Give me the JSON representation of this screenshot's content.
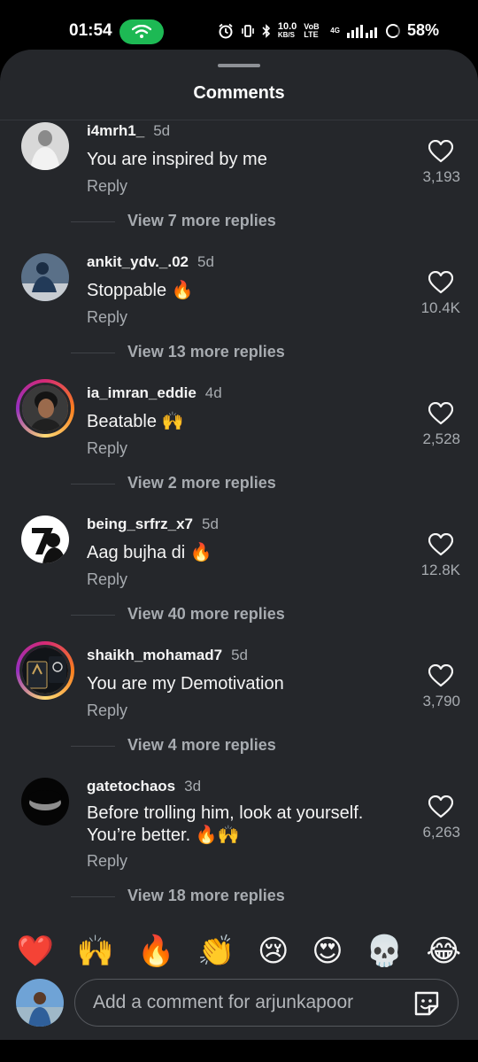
{
  "status_bar": {
    "time": "01:54",
    "net_speed": "10.0",
    "net_unit": "KB/S",
    "volte": "VoB LTE",
    "signal_label": "4G",
    "battery": "58%"
  },
  "sheet": {
    "title": "Comments"
  },
  "comments": [
    {
      "username": "i4mrh1_",
      "time": "5d",
      "text": "You are inspired by me",
      "reply": "Reply",
      "likes": "3,193",
      "view_more": "View 7 more replies"
    },
    {
      "username": "ankit_ydv._.02",
      "time": "5d",
      "text": "Stoppable 🔥",
      "reply": "Reply",
      "likes": "10.4K",
      "view_more": "View 13 more replies"
    },
    {
      "username": "ia_imran_eddie",
      "time": "4d",
      "text": "Beatable 🙌",
      "reply": "Reply",
      "likes": "2,528",
      "view_more": "View 2 more replies"
    },
    {
      "username": "being_srfrz_x7",
      "time": "5d",
      "text": "Aag bujha di 🔥",
      "reply": "Reply",
      "likes": "12.8K",
      "view_more": "View 40 more replies"
    },
    {
      "username": "shaikh_mohamad7",
      "time": "5d",
      "text": "You are my Demotivation",
      "reply": "Reply",
      "likes": "3,790",
      "view_more": "View 4 more replies"
    },
    {
      "username": "gatetochaos",
      "time": "3d",
      "text": "Before trolling him, look at yourself. You’re better. 🔥🙌",
      "reply": "Reply",
      "likes": "6,263",
      "view_more": "View 18 more replies"
    }
  ],
  "emoji_reactions": [
    "❤️",
    "🙌",
    "🔥",
    "👏",
    "😢",
    "😍",
    "💀",
    "😂"
  ],
  "composer": {
    "placeholder": "Add a comment for arjunkapoor"
  },
  "colors": {
    "sheet_bg": "#25272b",
    "secondary_text": "#a7abb0",
    "hotspot_green": "#1db954"
  }
}
